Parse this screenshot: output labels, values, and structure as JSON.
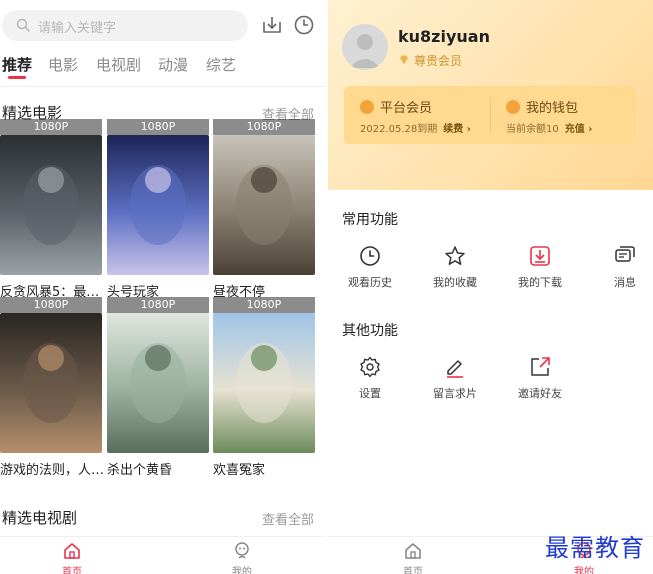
{
  "left": {
    "search": {
      "placeholder": "请输入关键字"
    },
    "tabs": [
      "推荐",
      "电影",
      "电视剧",
      "动漫",
      "综艺"
    ],
    "section_movies": {
      "title": "精选电影",
      "more": "查看全部",
      "items": [
        {
          "title": "反贪风暴5：最…",
          "quality": "1080P",
          "colors": [
            "#2a2f33",
            "#5a6168",
            "#9aa3a8"
          ]
        },
        {
          "title": "头号玩家",
          "quality": "1080P",
          "colors": [
            "#1d2557",
            "#5c6fc3",
            "#c9c3e8"
          ]
        },
        {
          "title": "昼夜不停",
          "quality": "1080P",
          "colors": [
            "#c9c4bb",
            "#8a8070",
            "#4a4036"
          ]
        },
        {
          "title": "游戏的法则，人…",
          "quality": "1080P",
          "colors": [
            "#2a2622",
            "#6b5a4a",
            "#b58f6a"
          ]
        },
        {
          "title": "杀出个黄昏",
          "quality": "1080P",
          "colors": [
            "#dfe6e0",
            "#9bb19e",
            "#5a6e5e"
          ]
        },
        {
          "title": "欢喜冤家",
          "quality": "1080P",
          "colors": [
            "#9fc5e8",
            "#e7e2d2",
            "#6b8b5a"
          ]
        }
      ]
    },
    "section_tv": {
      "title": "精选电视剧",
      "more": "查看全部"
    },
    "nav": [
      {
        "label": "首页",
        "icon": "home-icon"
      },
      {
        "label": "我的",
        "icon": "profile-icon"
      }
    ]
  },
  "right": {
    "username": "ku8ziyuan",
    "member_level": "尊贵会员",
    "vip": {
      "platform_label": "平台会员",
      "expire": "2022.05.28到期",
      "renew": "续费 ›",
      "wallet_label": "我的钱包",
      "balance": "当前余额10",
      "recharge": "充值 ›"
    },
    "common_title": "常用功能",
    "common": [
      {
        "label": "观看历史",
        "icon": "history-icon"
      },
      {
        "label": "我的收藏",
        "icon": "star-icon"
      },
      {
        "label": "我的下载",
        "icon": "download-icon"
      },
      {
        "label": "消息",
        "icon": "message-icon"
      }
    ],
    "other_title": "其他功能",
    "other": [
      {
        "label": "设置",
        "icon": "gear-icon"
      },
      {
        "label": "留言求片",
        "icon": "edit-icon"
      },
      {
        "label": "邀请好友",
        "icon": "share-icon"
      }
    ],
    "nav": [
      {
        "label": "首页",
        "icon": "home-icon"
      },
      {
        "label": "我的",
        "icon": "profile-icon"
      }
    ]
  },
  "watermark": "最需教育",
  "colors": {
    "accent": "#e8334a",
    "gold": "#c9942f",
    "vip_card": "#ffd98f"
  }
}
